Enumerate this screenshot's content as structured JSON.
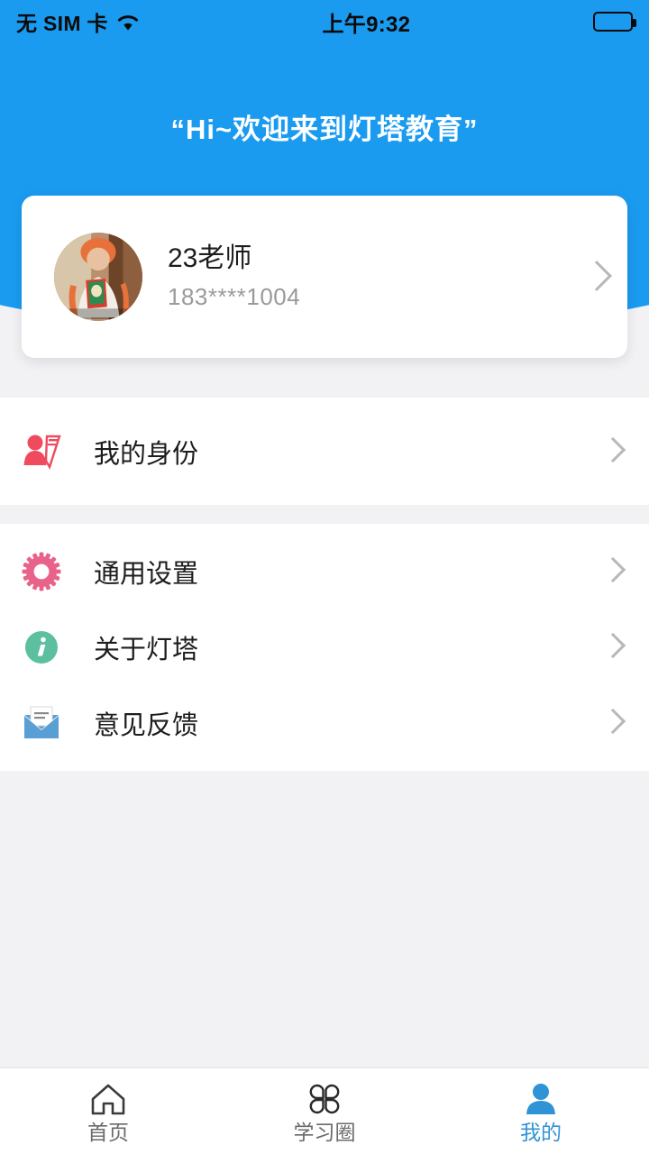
{
  "statusbar": {
    "carrier": "无 SIM 卡",
    "wifi_icon": "wifi-icon",
    "time": "上午9:32",
    "battery_icon": "battery-icon"
  },
  "header": {
    "welcome_text": "“Hi~欢迎来到灯塔教育”",
    "background_color": "#1a9bf0"
  },
  "profile": {
    "avatar_icon": "user-avatar-photo",
    "name": "23老师",
    "phone": "183****1004",
    "chevron_icon": "chevron-right-icon"
  },
  "sections": [
    {
      "items": [
        {
          "icon": "identity-card-icon",
          "icon_color": "#f04a5e",
          "label": "我的身份",
          "chevron_icon": "chevron-right-icon"
        }
      ]
    },
    {
      "items": [
        {
          "icon": "gear-icon",
          "icon_color": "#e8628a",
          "label": "通用设置",
          "chevron_icon": "chevron-right-icon"
        },
        {
          "icon": "info-circle-icon",
          "icon_color": "#5cc0a0",
          "label": "关于灯塔",
          "chevron_icon": "chevron-right-icon"
        },
        {
          "icon": "envelope-icon",
          "icon_color": "#5a9fd4",
          "label": "意见反馈",
          "chevron_icon": "chevron-right-icon"
        }
      ]
    }
  ],
  "tabbar": {
    "active_color": "#2f93d6",
    "inactive_color": "#6b6b6b",
    "tabs": [
      {
        "icon": "home-icon",
        "label": "首页",
        "active": false
      },
      {
        "icon": "clover-icon",
        "label": "学习圈",
        "active": false
      },
      {
        "icon": "person-icon",
        "label": "我的",
        "active": true
      }
    ]
  }
}
